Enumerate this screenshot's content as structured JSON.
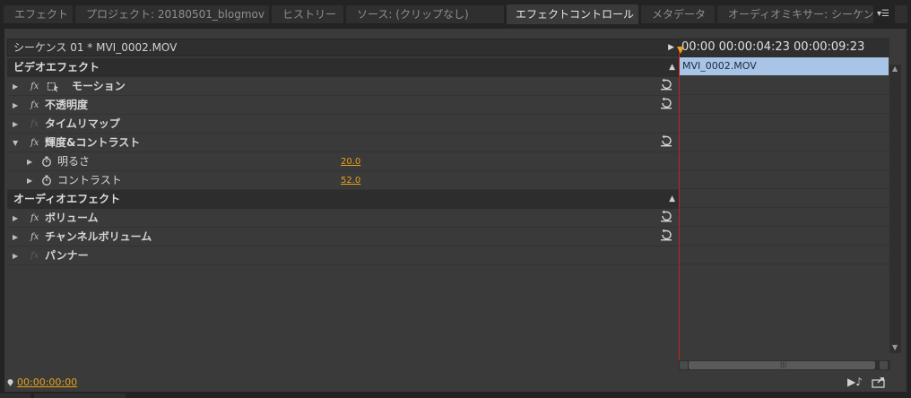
{
  "tabs": [
    {
      "label": "エフェクト"
    },
    {
      "label": "プロジェクト: 20180501_blogmov"
    },
    {
      "label": "ヒストリー"
    },
    {
      "label": "ソース: (クリップなし)"
    },
    {
      "label": "エフェクトコントロール",
      "close": "×"
    },
    {
      "label": "メタデータ"
    },
    {
      "label": "オーディオミキサー: シーケンス"
    }
  ],
  "panel_menu_icon": "panel-menu-icon",
  "sequence_header": {
    "label": "シーケンス 01 * MVI_0002.MOV"
  },
  "video_section": {
    "title": "ビデオエフェクト"
  },
  "video_effects": [
    {
      "label": "モーション",
      "fx_enabled": true,
      "expanded": false,
      "reset": true,
      "icon": "transform-icon"
    },
    {
      "label": "不透明度",
      "fx_enabled": true,
      "expanded": false,
      "reset": true
    },
    {
      "label": "タイムリマップ",
      "fx_enabled": false,
      "expanded": false,
      "reset": false
    },
    {
      "label": "輝度&コントラスト",
      "fx_enabled": true,
      "expanded": true,
      "reset": true,
      "params": [
        {
          "label": "明るさ",
          "value": "20.0"
        },
        {
          "label": "コントラスト",
          "value": "52.0"
        }
      ]
    }
  ],
  "audio_section": {
    "title": "オーディオエフェクト"
  },
  "audio_effects": [
    {
      "label": "ボリューム",
      "fx_enabled": true,
      "reset": true
    },
    {
      "label": "チャンネルボリューム",
      "fx_enabled": true,
      "reset": true
    },
    {
      "label": "パンナー",
      "fx_enabled": false,
      "reset": false
    }
  ],
  "timeline": {
    "ruler_text": "00:00 00:00:04:23 00:00:09:23",
    "clip_label": "MVI_0002.MOV"
  },
  "bottom": {
    "timecode": "00:00:00:00"
  },
  "colors": {
    "accent_timecode": "#e6a21c",
    "clip": "#a8c4e6",
    "playhead": "#cc2020"
  }
}
